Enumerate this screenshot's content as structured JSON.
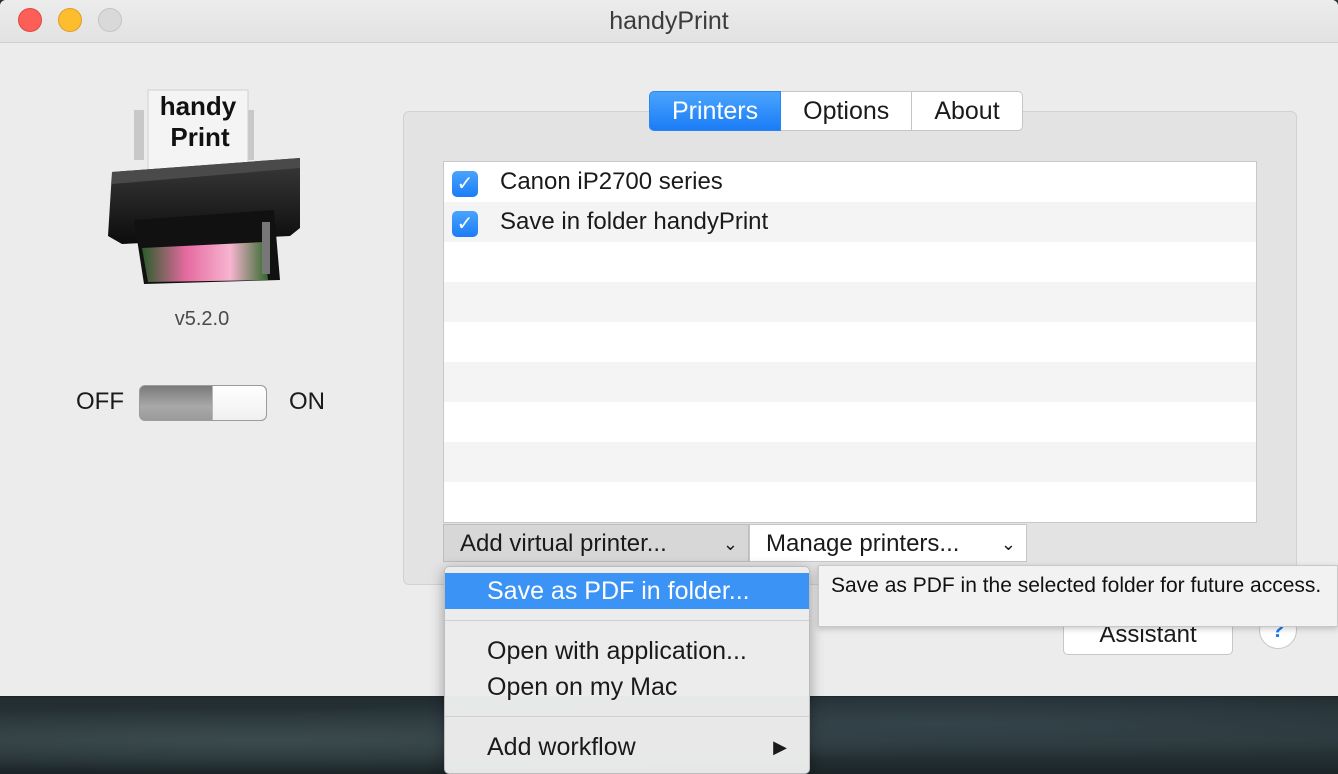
{
  "window": {
    "title": "handyPrint"
  },
  "logo": {
    "line1": "handy",
    "line2": "Print"
  },
  "version": "v5.2.0",
  "toggle": {
    "off_label": "OFF",
    "on_label": "ON"
  },
  "tabs": [
    {
      "label": "Printers",
      "active": true
    },
    {
      "label": "Options",
      "active": false
    },
    {
      "label": "About",
      "active": false
    }
  ],
  "printers": [
    {
      "label": "Canon iP2700 series",
      "checked": true
    },
    {
      "label": "Save in folder handyPrint",
      "checked": true
    }
  ],
  "buttons": {
    "add_virtual": "Add virtual printer...",
    "manage": "Manage printers...",
    "assistant": "Assistant",
    "help": "?"
  },
  "menu": {
    "items": [
      {
        "label": "Save as PDF in folder..."
      },
      {
        "label": "Open with application..."
      },
      {
        "label": "Open on my Mac"
      },
      {
        "label": "Add workflow"
      }
    ]
  },
  "tooltip": {
    "text": "Save as PDF in the selected folder for future access."
  },
  "colors": {
    "accent": "#1b7cf6",
    "highlight": "#3c93f6"
  }
}
